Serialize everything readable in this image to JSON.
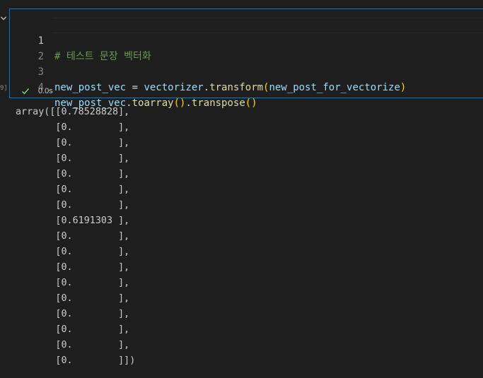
{
  "cell": {
    "execution_count": "9]",
    "lines": [
      {
        "number": "1",
        "tokens": [
          {
            "text": "# 테스트 문장 벡터화",
            "type": "comment"
          }
        ]
      },
      {
        "number": "2",
        "tokens": []
      },
      {
        "number": "3",
        "tokens": [
          {
            "text": "new_post_vec",
            "type": "var"
          },
          {
            "text": " = ",
            "type": "op"
          },
          {
            "text": "vectorizer",
            "type": "var"
          },
          {
            "text": ".",
            "type": "op"
          },
          {
            "text": "transform",
            "type": "fn"
          },
          {
            "text": "(",
            "type": "paren"
          },
          {
            "text": "new_post_for_vectorize",
            "type": "var"
          },
          {
            "text": ")",
            "type": "paren"
          }
        ]
      },
      {
        "number": "4",
        "tokens": [
          {
            "text": "new_post_vec",
            "type": "var"
          },
          {
            "text": ".",
            "type": "op"
          },
          {
            "text": "toarray",
            "type": "fn"
          },
          {
            "text": "()",
            "type": "paren"
          },
          {
            "text": ".",
            "type": "op"
          },
          {
            "text": "transpose",
            "type": "fn"
          },
          {
            "text": "()",
            "type": "paren"
          }
        ]
      }
    ],
    "status": {
      "icon": "check-icon",
      "success_color": "#89d185",
      "time": "0.0s"
    }
  },
  "output": {
    "lines": [
      "array([[0.78528828],",
      "       [0.        ],",
      "       [0.        ],",
      "       [0.        ],",
      "       [0.        ],",
      "       [0.        ],",
      "       [0.        ],",
      "       [0.6191303 ],",
      "       [0.        ],",
      "       [0.        ],",
      "       [0.        ],",
      "       [0.        ],",
      "       [0.        ],",
      "       [0.        ],",
      "       [0.        ],",
      "       [0.        ],",
      "       [0.        ]])"
    ]
  },
  "colors": {
    "background": "#1e1e1e",
    "focus_border": "#007acc",
    "comment": "#6a9955",
    "variable": "#9cdcfe",
    "function": "#dcdcaa",
    "bracket": "#ffd700",
    "text": "#cccccc"
  }
}
